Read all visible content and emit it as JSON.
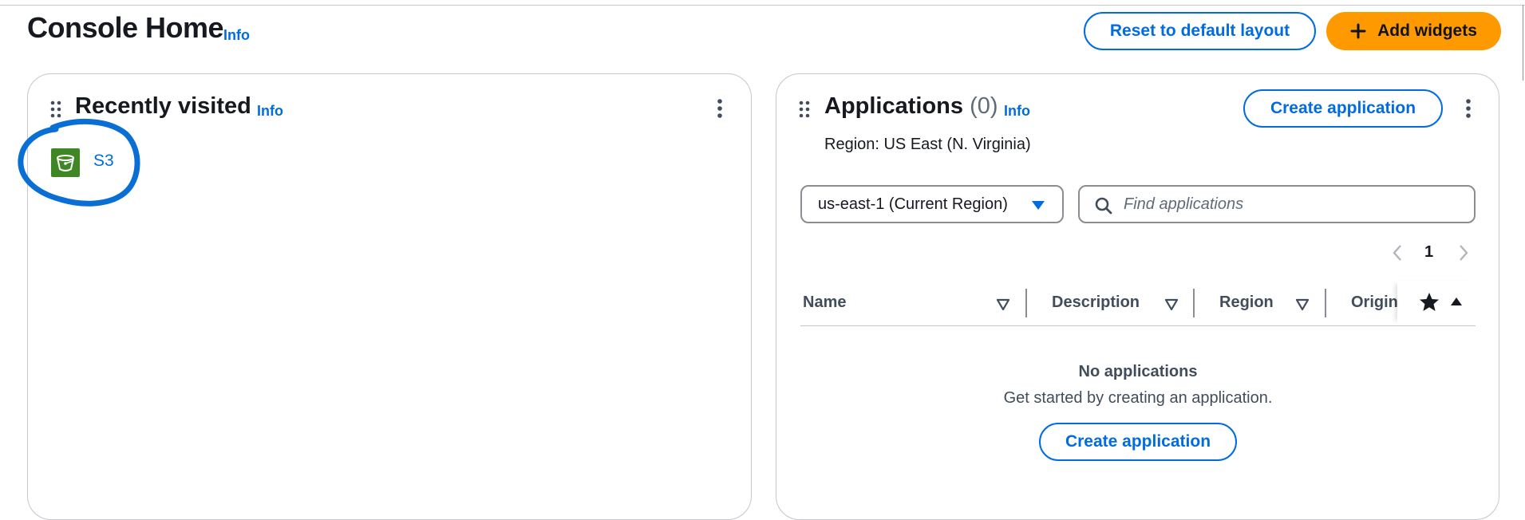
{
  "header": {
    "title": "Console Home",
    "info": "Info",
    "reset_label": "Reset to default layout",
    "add_widgets_label": "Add widgets"
  },
  "recently_visited": {
    "title": "Recently visited",
    "info": "Info",
    "items": [
      {
        "label": "S3",
        "icon": "s3-bucket-icon"
      }
    ]
  },
  "applications": {
    "title": "Applications",
    "count": "(0)",
    "info": "Info",
    "create_label": "Create application",
    "region_text": "Region: US East (N. Virginia)",
    "region_select": "us-east-1 (Current Region)",
    "search_placeholder": "Find applications",
    "page": "1",
    "columns": [
      "Name",
      "Description",
      "Region",
      "Origin"
    ],
    "empty_title": "No applications",
    "empty_subtitle": "Get started by creating an application.",
    "empty_create_label": "Create application"
  },
  "colors": {
    "link": "#006ce0",
    "primary": "#ff9900",
    "annotation": "#0a6fd4",
    "s3_green": "#3f8624"
  }
}
